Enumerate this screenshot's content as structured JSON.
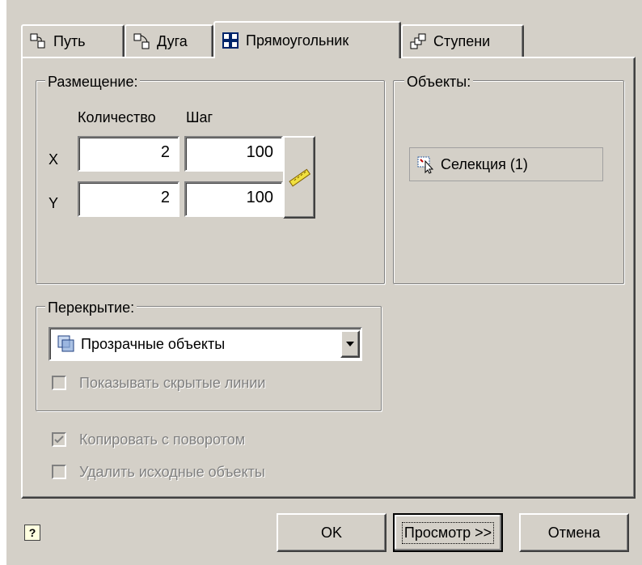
{
  "tabs": [
    {
      "label": "Путь",
      "icon": "path-array-icon"
    },
    {
      "label": "Дуга",
      "icon": "arc-array-icon"
    },
    {
      "label": "Прямоугольник",
      "icon": "rectangular-array-icon"
    },
    {
      "label": "Ступени",
      "icon": "stairs-array-icon"
    }
  ],
  "placement": {
    "legend": "Размещение:",
    "count_header": "Количество",
    "step_header": "Шаг",
    "row_x_label": "X",
    "row_y_label": "Y",
    "x_count": "2",
    "x_step": "100",
    "y_count": "2",
    "y_step": "100"
  },
  "objects": {
    "legend": "Объекты:",
    "selection_label": "Селекция (1)"
  },
  "overlap": {
    "legend": "Перекрытие:",
    "selected": "Прозрачные объекты",
    "show_hidden_label": "Показывать скрытые линии"
  },
  "options": {
    "copy_rotation_label": "Копировать с поворотом",
    "delete_source_label": "Удалить исходные объекты"
  },
  "footer": {
    "help_symbol": "?",
    "ok_label": "OK",
    "preview_label": "Просмотр >>",
    "cancel_label": "Отмена"
  },
  "colors": {
    "dialog_bg": "#d4d0c8",
    "disabled_text": "#808080",
    "ruler_yellow": "#f0e040"
  }
}
